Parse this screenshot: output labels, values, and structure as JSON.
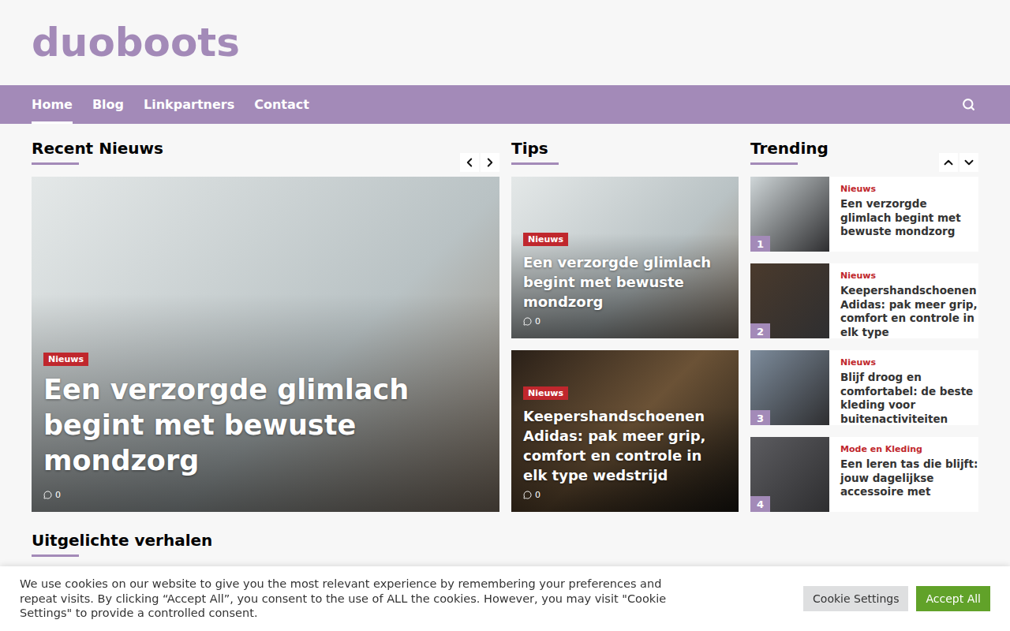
{
  "logo": "duoboots",
  "nav": [
    {
      "label": "Home",
      "selected": true
    },
    {
      "label": "Blog",
      "selected": false
    },
    {
      "label": "Linkpartners",
      "selected": false
    },
    {
      "label": "Contact",
      "selected": false
    }
  ],
  "recent": {
    "title": "Recent Nieuws",
    "slides": [
      {
        "category": "Nieuws",
        "title": "Een verzorgde glimlach begint met bewuste mondzorg",
        "comments": "0"
      }
    ]
  },
  "tips": {
    "title": "Tips",
    "posts": [
      {
        "category": "Nieuws",
        "title": "Een verzorgde glimlach begint met bewuste mondzorg",
        "comments": "0"
      },
      {
        "category": "Nieuws",
        "title": "Keepershandschoenen Adidas: pak meer grip, comfort en controle in elk type wedstrijd",
        "comments": "0"
      }
    ]
  },
  "trending": {
    "title": "Trending",
    "items": [
      {
        "rank": "1",
        "category": "Nieuws",
        "title": "Een verzorgde glimlach begint met bewuste mondzorg"
      },
      {
        "rank": "2",
        "category": "Nieuws",
        "title": "Keepershandschoenen Adidas: pak meer grip, comfort en controle in elk type"
      },
      {
        "rank": "3",
        "category": "Nieuws",
        "title": "Blijf droog en comfortabel: de beste kleding voor buitenactiviteiten"
      },
      {
        "rank": "4",
        "category": "Mode en Kleding",
        "title": "Een leren tas die blijft: jouw dagelijkse accessoire met"
      }
    ]
  },
  "featured": {
    "title": "Uitgelichte verhalen"
  },
  "cookie": {
    "text": "We use cookies on our website to give you the most relevant experience by remembering your preferences and repeat visits. By clicking “Accept All”, you consent to the use of ALL the cookies. However, you may visit \"Cookie Settings\" to provide a controlled consent.",
    "buttons": [
      {
        "label": "Cookie Settings",
        "kind": "secondary"
      },
      {
        "label": "Accept All",
        "kind": "primary"
      }
    ]
  }
}
